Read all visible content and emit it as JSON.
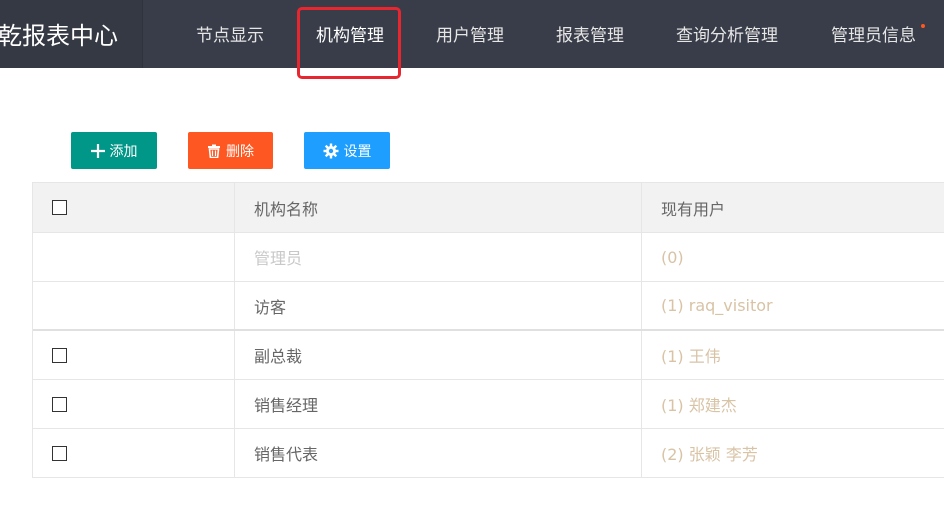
{
  "header": {
    "brand": "乾报表中心",
    "nav": [
      {
        "label": "节点显示"
      },
      {
        "label": "机构管理"
      },
      {
        "label": "用户管理"
      },
      {
        "label": "报表管理"
      },
      {
        "label": "查询分析管理"
      },
      {
        "label": "管理员信息"
      }
    ],
    "active_index": 1,
    "colors": {
      "bar": "#393d49",
      "highlight": "#e8262f",
      "dot": "#ff5722"
    }
  },
  "toolbar": {
    "add_label": "添加",
    "delete_label": "删除",
    "settings_label": "设置",
    "colors": {
      "add": "#009688",
      "delete": "#ff5722",
      "settings": "#1e9fff"
    }
  },
  "table": {
    "columns": [
      "机构名称",
      "现有用户"
    ],
    "rows": [
      {
        "name": "管理员",
        "users": "(0)",
        "checkbox": false,
        "disabled": true
      },
      {
        "name": "访客",
        "users": "(1) raq_visitor",
        "checkbox": false,
        "disabled": false
      },
      {
        "name": "副总裁",
        "users": "(1) 王伟",
        "checkbox": true,
        "disabled": false
      },
      {
        "name": "销售经理",
        "users": "(1) 郑建杰",
        "checkbox": true,
        "disabled": false
      },
      {
        "name": "销售代表",
        "users": "(2) 张颖 李芳",
        "checkbox": true,
        "disabled": false
      }
    ]
  }
}
